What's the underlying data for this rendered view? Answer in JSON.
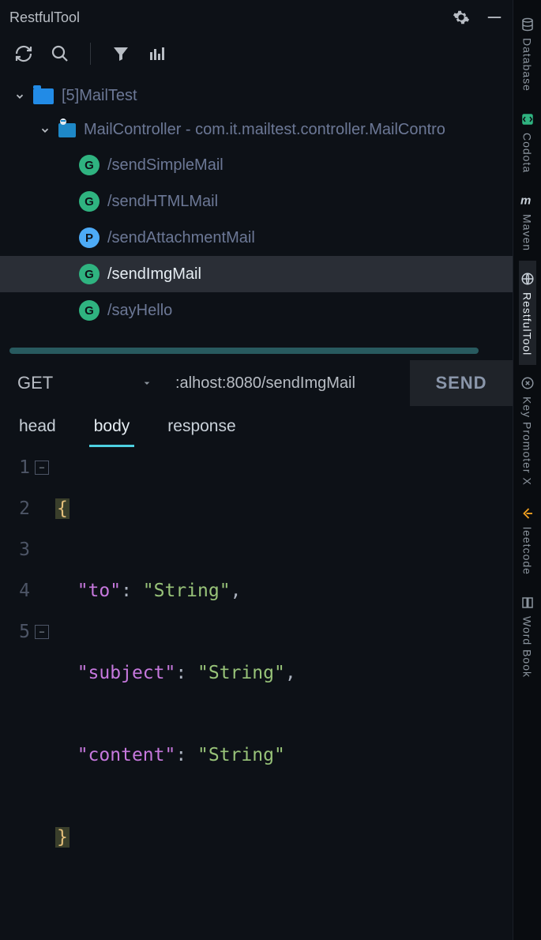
{
  "header": {
    "title": "RestfulTool"
  },
  "toolbar": {
    "refresh": "refresh",
    "search": "search",
    "filter": "filter",
    "stats": "stats"
  },
  "tree": {
    "root": {
      "label": "[5]MailTest"
    },
    "controller": {
      "label": "MailController - com.it.mailtest.controller.MailContro"
    },
    "endpoints": [
      {
        "method": "G",
        "path": "/sendSimpleMail",
        "selected": false,
        "type": "get"
      },
      {
        "method": "G",
        "path": "/sendHTMLMail",
        "selected": false,
        "type": "get"
      },
      {
        "method": "P",
        "path": "/sendAttachmentMail",
        "selected": false,
        "type": "post"
      },
      {
        "method": "G",
        "path": "/sendImgMail",
        "selected": true,
        "type": "get"
      },
      {
        "method": "G",
        "path": "/sayHello",
        "selected": false,
        "type": "get"
      }
    ]
  },
  "request": {
    "method": "GET",
    "url": ":alhost:8080/sendImgMail",
    "send_label": "SEND"
  },
  "tabs": [
    {
      "label": "head",
      "active": false
    },
    {
      "label": "body",
      "active": true
    },
    {
      "label": "response",
      "active": false
    }
  ],
  "editor": {
    "lines": [
      {
        "n": "1",
        "fold": "−",
        "brace_open": "{"
      },
      {
        "n": "2",
        "key": "\"to\"",
        "val": "\"String\"",
        "comma": ","
      },
      {
        "n": "3",
        "key": "\"subject\"",
        "val": "\"String\"",
        "comma": ","
      },
      {
        "n": "4",
        "key": "\"content\"",
        "val": "\"String\""
      },
      {
        "n": "5",
        "fold": "−",
        "brace_close": "}"
      }
    ]
  },
  "rail": [
    {
      "label": "Database",
      "icon": "database"
    },
    {
      "label": "Codota",
      "icon": "codota"
    },
    {
      "label": "Maven",
      "icon": "maven"
    },
    {
      "label": "RestfulTool",
      "icon": "globe",
      "active": true
    },
    {
      "label": "Key Promoter X",
      "icon": "keypromoter"
    },
    {
      "label": "leetcode",
      "icon": "leetcode"
    },
    {
      "label": "Word Book",
      "icon": "wordbook"
    }
  ]
}
